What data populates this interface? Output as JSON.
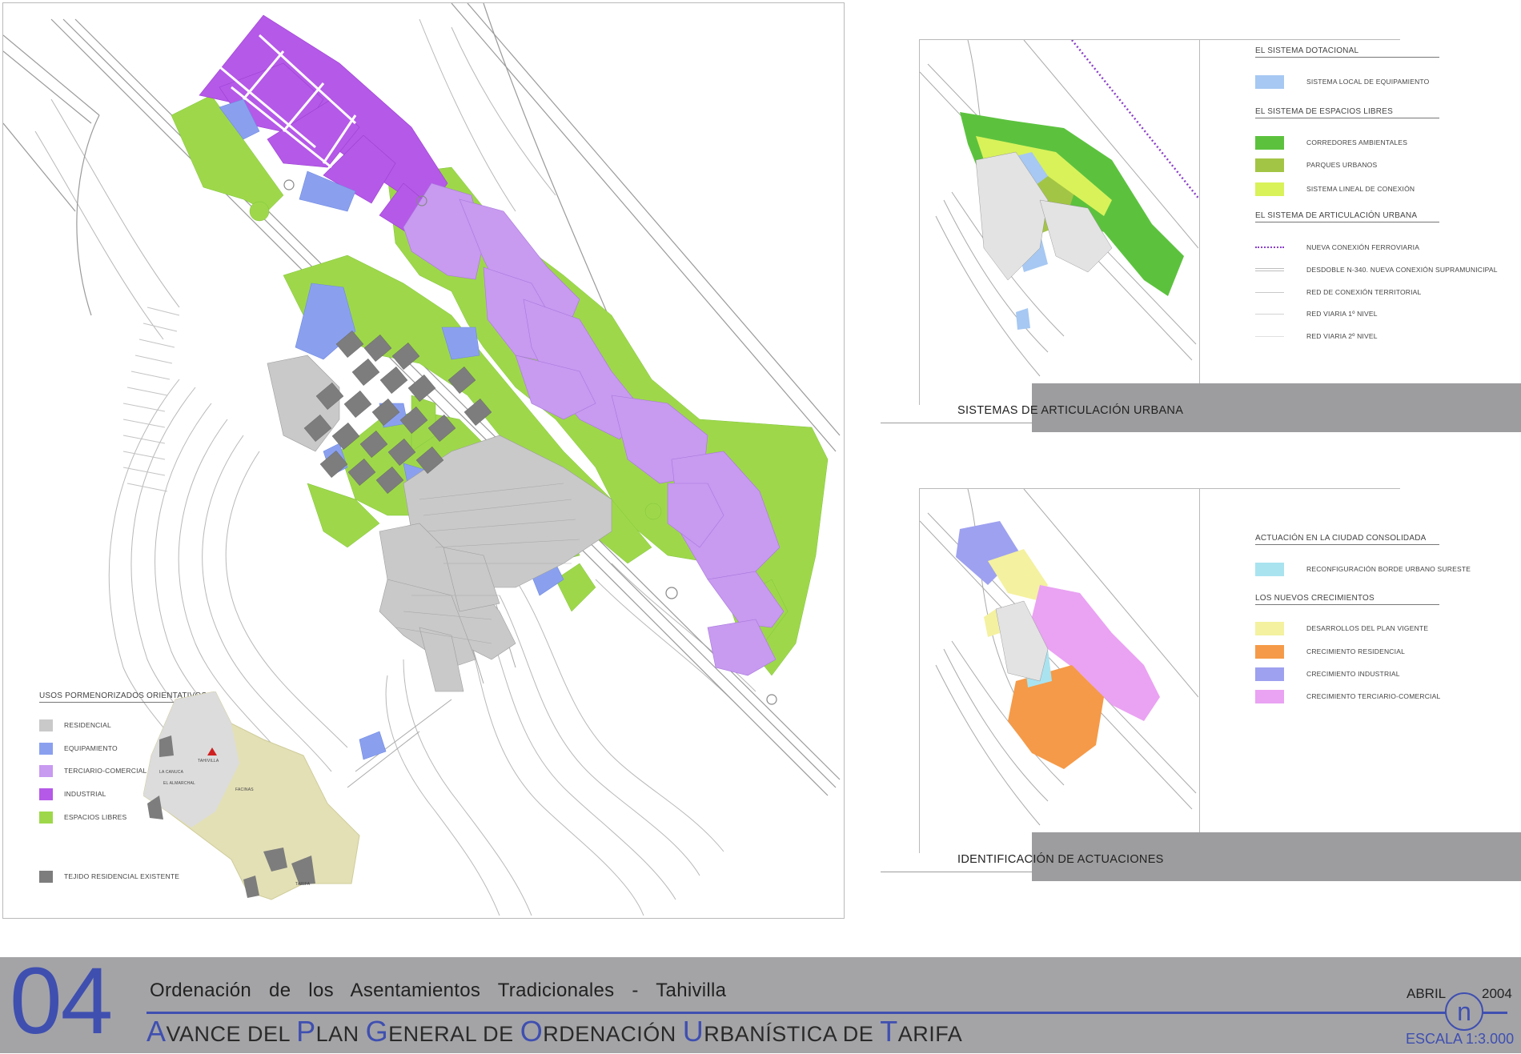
{
  "main_map": {
    "legend": {
      "title": "USOS PORMENORIZADOS ORIENTATIVOS",
      "items": [
        {
          "label": "RESIDENCIAL",
          "color": "#c9c9c9"
        },
        {
          "label": "EQUIPAMIENTO",
          "color": "#8aa0ef"
        },
        {
          "label": "TERCIARIO-COMERCIAL",
          "color": "#c89af0"
        },
        {
          "label": "INDUSTRIAL",
          "color": "#b559e8"
        },
        {
          "label": "ESPACIOS LIBRES",
          "color": "#9ed84a"
        }
      ],
      "existing": {
        "label": "TEJIDO RESIDENCIAL EXISTENTE",
        "color": "#7d7d7d"
      }
    },
    "inset_labels": [
      "TAHIVILLA",
      "LA CANUCA",
      "EL ALMARCHAL",
      "FACINAS",
      "TARIFA"
    ]
  },
  "panel_sistemas": {
    "caption": "SISTEMAS DE ARTICULACIÓN URBANA",
    "groups": [
      {
        "title": "EL SISTEMA DOTACIONAL",
        "items": [
          {
            "label": "SISTEMA LOCAL DE EQUIPAMIENTO",
            "color": "#a6c8f2",
            "kind": "swatch"
          }
        ]
      },
      {
        "title": "EL SISTEMA DE ESPACIOS LIBRES",
        "items": [
          {
            "label": "CORREDORES AMBIENTALES",
            "color": "#5cc23e",
            "kind": "swatch"
          },
          {
            "label": "PARQUES URBANOS",
            "color": "#a3c545",
            "kind": "swatch"
          },
          {
            "label": "SISTEMA LINEAL DE CONEXIÓN",
            "color": "#d9f25a",
            "kind": "swatch"
          }
        ]
      },
      {
        "title": "EL SISTEMA DE ARTICULACIÓN URBANA",
        "items": [
          {
            "label": "NUEVA CONEXIÓN FERROVIARIA",
            "color": "#8a3fc8",
            "kind": "dotted"
          },
          {
            "label": "DESDOBLE N-340. NUEVA CONEXIÓN SUPRAMUNICIPAL",
            "color": "#bdbdbd",
            "kind": "double"
          },
          {
            "label": "RED DE CONEXIÓN TERRITORIAL",
            "color": "#c9c9c9",
            "kind": "line"
          },
          {
            "label": "RED VIARIA 1º NIVEL",
            "color": "#d3d3d3",
            "kind": "line"
          },
          {
            "label": "RED VIARIA 2º NIVEL",
            "color": "#e0e0e0",
            "kind": "line"
          }
        ]
      }
    ]
  },
  "panel_actuaciones": {
    "caption": "IDENTIFICACIÓN DE ACTUACIONES",
    "groups": [
      {
        "title": "ACTUACIÓN EN LA CIUDAD CONSOLIDADA",
        "items": [
          {
            "label": "RECONFIGURACIÓN BORDE URBANO SURESTE",
            "color": "#a9e3f0"
          }
        ]
      },
      {
        "title": "LOS NUEVOS CRECIMIENTOS",
        "items": [
          {
            "label": "DESARROLLOS DEL PLAN VIGENTE",
            "color": "#f4f1a0"
          },
          {
            "label": "CRECIMIENTO RESIDENCIAL",
            "color": "#f59a48"
          },
          {
            "label": "CRECIMIENTO INDUSTRIAL",
            "color": "#9ea1ef"
          },
          {
            "label": "CRECIMIENTO TERCIARIO-COMERCIAL",
            "color": "#eaa2f3"
          }
        ]
      }
    ]
  },
  "footer": {
    "number": "04",
    "subtitle": "Ordenación de los Asentamientos Tradicionales - Tahivilla",
    "title_parts": [
      {
        "t": "A",
        "big": true
      },
      {
        "t": "VANCE ",
        "big": false
      },
      {
        "t": "DEL ",
        "big": false
      },
      {
        "t": "P",
        "big": true
      },
      {
        "t": "LAN ",
        "big": false
      },
      {
        "t": "G",
        "big": true
      },
      {
        "t": "ENERAL DE ",
        "big": false
      },
      {
        "t": "O",
        "big": true
      },
      {
        "t": "RDENACIÓN ",
        "big": false
      },
      {
        "t": "U",
        "big": true
      },
      {
        "t": "RBANÍSTICA DE ",
        "big": false
      },
      {
        "t": "T",
        "big": true
      },
      {
        "t": "ARIFA",
        "big": false
      }
    ],
    "month": "ABRIL",
    "year": "2004",
    "logo_letter": "n",
    "scale": "ESCALA 1:3.000"
  },
  "colors": {
    "accent_blue": "#3f4fb0",
    "footer_grey": "#a4a4a7"
  }
}
